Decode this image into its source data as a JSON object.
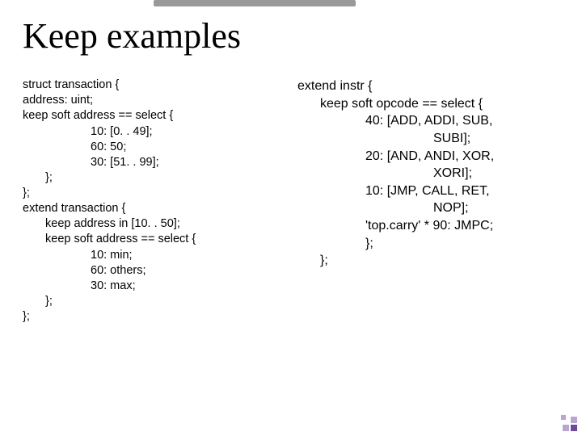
{
  "title": "Keep examples",
  "left": {
    "l0": "struct transaction {",
    "l1": "address: uint;",
    "l2": "keep soft address == select {",
    "l3": "10: [0. . 49];",
    "l4": "60: 50;",
    "l5": "30: [51. . 99];",
    "l6": "};",
    "l7": "};",
    "l8": "extend transaction {",
    "l9": "keep address in [10. . 50];",
    "l10": "keep soft address == select {",
    "l11": "10: min;",
    "l12": "60: others;",
    "l13": "30: max;",
    "l14": "};",
    "l15": "};"
  },
  "right": {
    "r0": "extend instr {",
    "r1": "keep soft opcode == select {",
    "r2": "40: [ADD, ADDI, SUB,",
    "r3": "SUBI];",
    "r4": "20: [AND, ANDI, XOR,",
    "r5": "XORI];",
    "r6": "10: [JMP, CALL, RET,",
    "r7": "NOP];",
    "r8": "'top.carry' * 90: JMPC;",
    "r9": "};",
    "r10": "};"
  }
}
